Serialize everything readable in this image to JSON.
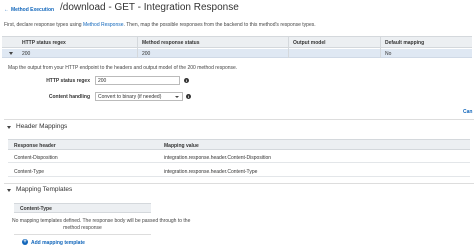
{
  "header": {
    "back_link": "Method Execution",
    "title": "/download - GET - Integration Response"
  },
  "intro": {
    "text_before": "First, declare response types using ",
    "link": "Method Response",
    "text_after": ". Then, map the possible responses from the backend to this method's response types."
  },
  "response_table": {
    "columns": [
      "HTTP status regex",
      "Method response status",
      "Output model",
      "Default mapping"
    ],
    "row": {
      "regex": "200",
      "status": "200",
      "model": "",
      "default_mapping": "No"
    }
  },
  "mapping_form": {
    "description": "Map the output from your HTTP endpoint to the headers and output model of the 200 method response.",
    "regex_label": "HTTP status regex",
    "regex_value": "200",
    "content_handling_label": "Content handling",
    "content_handling_value": "Convert to binary (if needed)",
    "cancel": "Can"
  },
  "header_mappings": {
    "title": "Header Mappings",
    "columns": [
      "Response header",
      "Mapping value"
    ],
    "rows": [
      {
        "header": "Content-Disposition",
        "value": "integration.response.header.Content-Disposition"
      },
      {
        "header": "Content-Type",
        "value": "integration.response.header.Content-Type"
      }
    ]
  },
  "mapping_templates": {
    "title": "Mapping Templates",
    "column": "Content-Type",
    "empty_line1": "No mapping templates defined. The response body will be passed through to the",
    "empty_line2": "method response",
    "add_label": "Add mapping template"
  }
}
